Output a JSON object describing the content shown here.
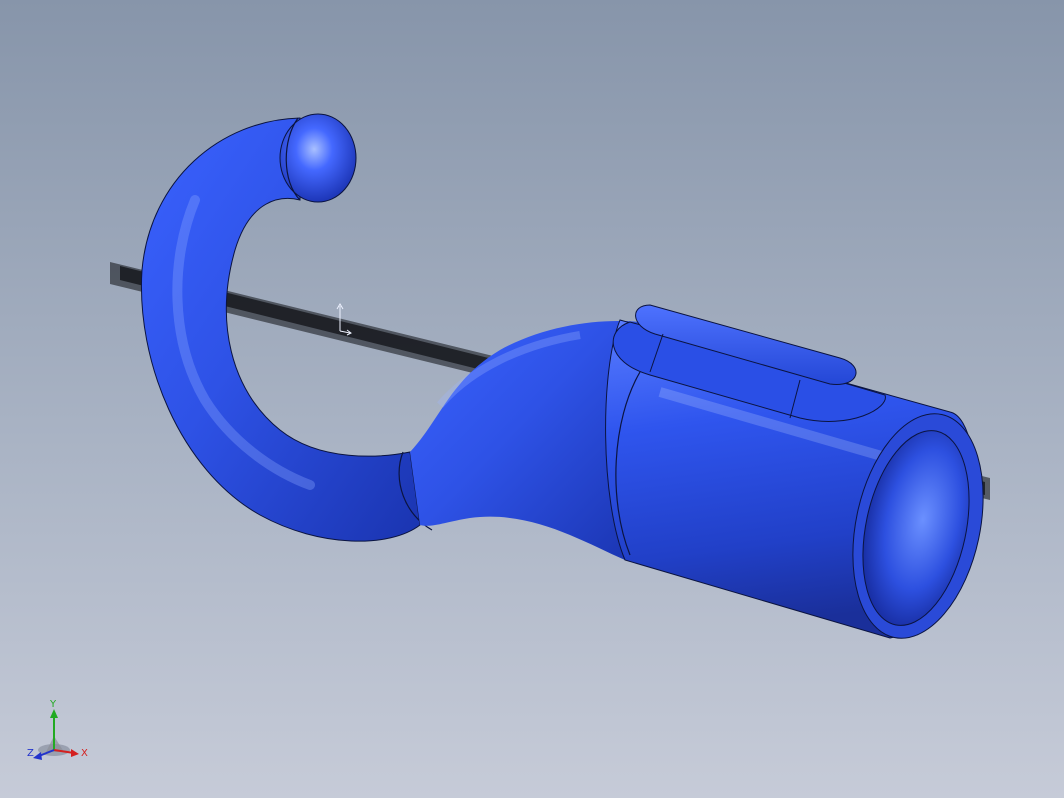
{
  "viewport": {
    "model_color": "#2e52e6",
    "background_top": "#8795aa",
    "background_bottom": "#c6cbd8"
  },
  "triad": {
    "x_label": "X",
    "y_label": "Y",
    "z_label": "Z",
    "x_color": "#d42020",
    "y_color": "#22aa22",
    "z_color": "#2233cc"
  },
  "icons": {
    "origin": "origin-marker-icon",
    "triad": "view-orientation-triad-icon"
  }
}
